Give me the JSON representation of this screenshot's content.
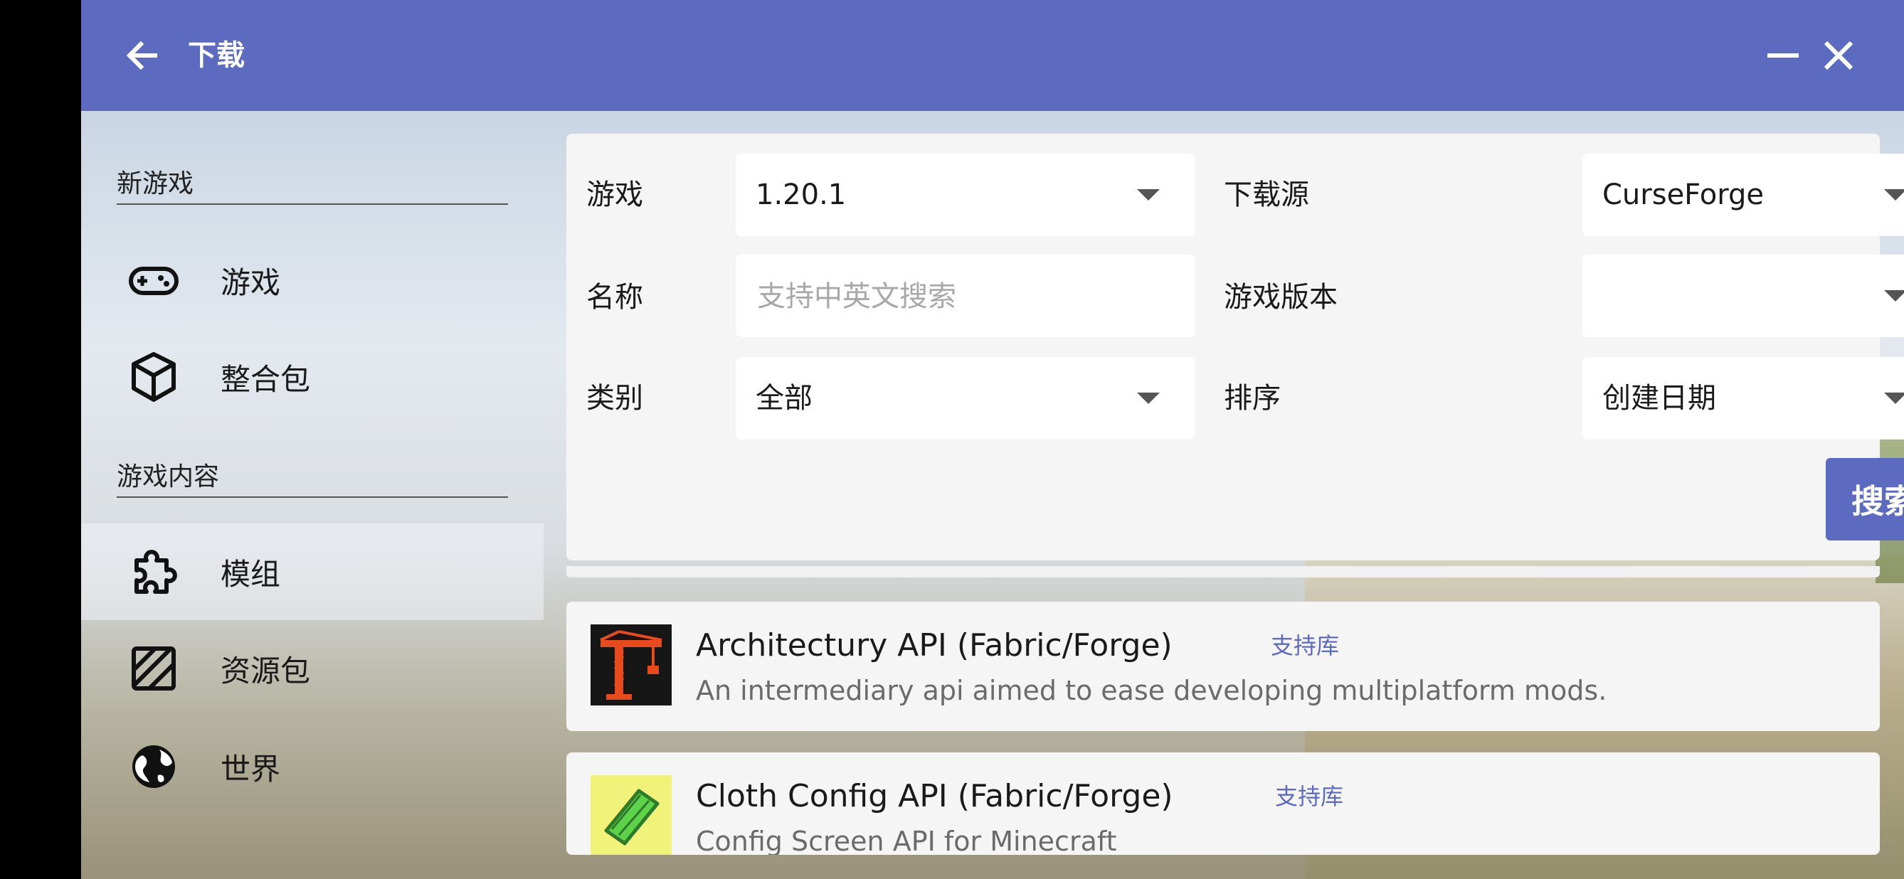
{
  "colors": {
    "accent": "#5c6bc0",
    "panel": "#f5f5f5",
    "text": "#1a1a1a",
    "muted": "#6b6b6b",
    "placeholder": "#a8a8a8"
  },
  "titlebar": {
    "title": "下载",
    "back_icon": "arrow-left-icon",
    "minimize_icon": "minimize-icon",
    "close_icon": "close-icon"
  },
  "sidebar": {
    "sections": [
      {
        "header": "新游戏",
        "items": [
          {
            "label": "游戏",
            "icon": "gamepad-icon"
          },
          {
            "label": "整合包",
            "icon": "package-icon"
          }
        ]
      },
      {
        "header": "游戏内容",
        "items": [
          {
            "label": "模组",
            "icon": "puzzle-icon",
            "active": true
          },
          {
            "label": "资源包",
            "icon": "texture-icon"
          },
          {
            "label": "世界",
            "icon": "globe-icon"
          }
        ]
      }
    ]
  },
  "search": {
    "game": {
      "label": "游戏",
      "value": "1.20.1"
    },
    "source": {
      "label": "下载源",
      "value": "CurseForge"
    },
    "name": {
      "label": "名称",
      "placeholder": "支持中英文搜索",
      "value": ""
    },
    "game_version": {
      "label": "游戏版本",
      "value": ""
    },
    "category": {
      "label": "类别",
      "value": "全部"
    },
    "sort": {
      "label": "排序",
      "value": "创建日期"
    },
    "button_label": "搜索"
  },
  "results": [
    {
      "title": "Architectury API (Fabric/Forge)",
      "tag": "支持库",
      "description": "An intermediary api aimed to ease developing multiplatform mods.",
      "icon": "crane-icon"
    },
    {
      "title": "Cloth Config API (Fabric/Forge)",
      "tag": "支持库",
      "description": "Config Screen API for Minecraft",
      "icon": "cloth-icon"
    }
  ]
}
